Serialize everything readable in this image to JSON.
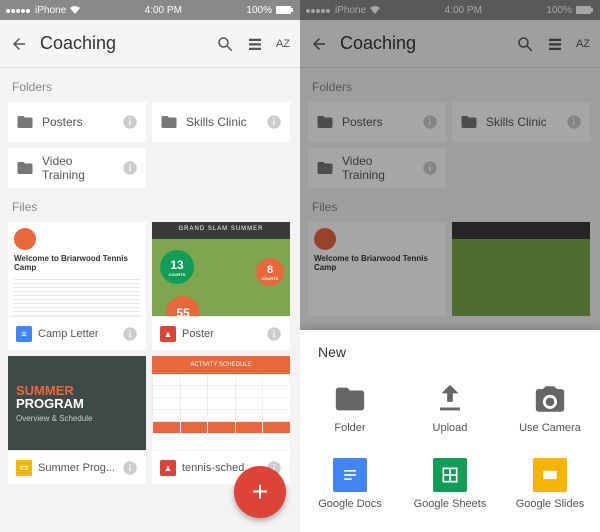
{
  "status": {
    "carrier": "iPhone",
    "time": "4:00 PM",
    "battery": "100%"
  },
  "header": {
    "title": "Coaching",
    "sort": "AZ"
  },
  "labels": {
    "folders": "Folders",
    "files": "Files"
  },
  "folders": [
    {
      "name": "Posters"
    },
    {
      "name": "Skills Clinic"
    },
    {
      "name": "Video Training"
    }
  ],
  "files": [
    {
      "name": "Camp Letter",
      "type": "docs"
    },
    {
      "name": "Poster",
      "type": "pdf"
    },
    {
      "name": "Summer Prog...",
      "type": "slides"
    },
    {
      "name": "tennis-sched...",
      "type": "pdf"
    }
  ],
  "thumb_text": {
    "camp_heading": "Welcome to Briarwood Tennis Camp",
    "poster_top": "GRAND SLAM SUMMER",
    "poster_badge1": "13",
    "poster_badge1_sub": "COURTS",
    "poster_badge2": "55",
    "poster_badge3": "8",
    "poster_badge3_sub": "COURTS",
    "summer1": "SUMMER",
    "summer2": "PROGRAM",
    "summer3": "Overview & Schedule",
    "sched_hdr": "ACTIVITY SCHEDULE"
  },
  "sheet": {
    "title": "New",
    "items": [
      {
        "label": "Folder",
        "icon": "folder"
      },
      {
        "label": "Upload",
        "icon": "upload"
      },
      {
        "label": "Use Camera",
        "icon": "camera"
      },
      {
        "label": "Google Docs",
        "icon": "docs"
      },
      {
        "label": "Google Sheets",
        "icon": "sheets"
      },
      {
        "label": "Google Slides",
        "icon": "slides"
      }
    ]
  }
}
